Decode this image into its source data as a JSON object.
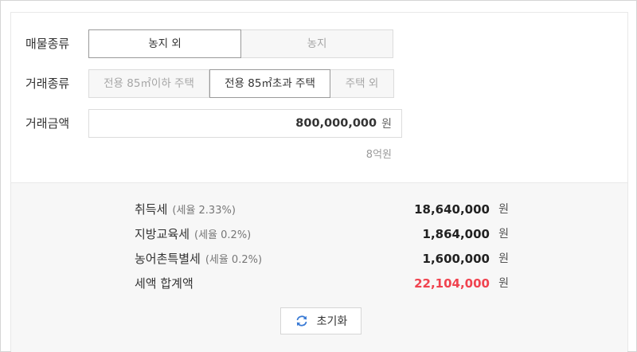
{
  "property_type": {
    "label": "매물종류",
    "options": [
      "농지 외",
      "농지"
    ],
    "selected": "농지 외"
  },
  "transaction_type": {
    "label": "거래종류",
    "options": [
      "전용 85㎡이하 주택",
      "전용 85㎡초과 주택",
      "주택 외"
    ],
    "selected": "전용 85㎡초과 주택"
  },
  "transaction_amount": {
    "label": "거래금액",
    "value": "800,000,000",
    "unit": "원",
    "korean_reading": "8억원"
  },
  "taxes": [
    {
      "name": "취득세",
      "rate": "(세율 2.33%)",
      "amount": "18,640,000",
      "unit": "원"
    },
    {
      "name": "지방교육세",
      "rate": "(세율 0.2%)",
      "amount": "1,864,000",
      "unit": "원"
    },
    {
      "name": "농어촌특별세",
      "rate": "(세율 0.2%)",
      "amount": "1,600,000",
      "unit": "원"
    }
  ],
  "total": {
    "name": "세액 합계액",
    "amount": "22,104,000",
    "unit": "원",
    "color": "#f0434f"
  },
  "reset_button": {
    "label": "초기화",
    "icon": "refresh-icon",
    "icon_color": "#3a7bd5"
  }
}
